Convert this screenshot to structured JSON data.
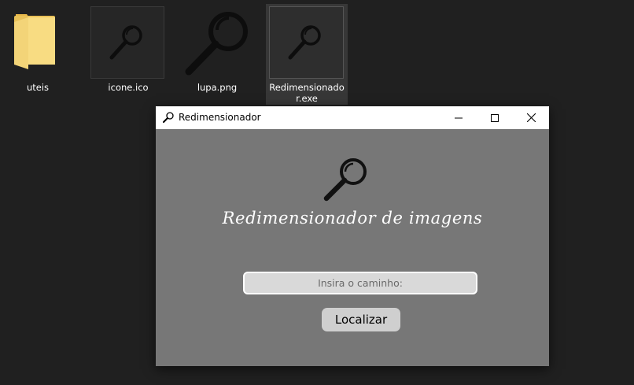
{
  "desktop": {
    "items": [
      {
        "label": "uteis",
        "icon": "folder-icon"
      },
      {
        "label": "icone.ico",
        "icon": "magnifier-icon"
      },
      {
        "label": "lupa.png",
        "icon": "magnifier-icon"
      },
      {
        "label_line1": "Redimensionado",
        "label_line2": "r.exe",
        "icon": "magnifier-icon",
        "selected": true
      }
    ]
  },
  "window": {
    "title": "Redimensionador",
    "controls": {
      "minimize": "minimize-icon",
      "maximize": "maximize-icon",
      "close": "close-icon"
    },
    "heading": "Redimensionador de imagens",
    "path_input": {
      "placeholder": "Insira o caminho:",
      "value": ""
    },
    "locate_button": "Localizar"
  },
  "colors": {
    "desktop_bg": "#202020",
    "window_bg": "#777777",
    "titlebar_bg": "#ffffff",
    "folder_yellow": "#f5d36b"
  }
}
